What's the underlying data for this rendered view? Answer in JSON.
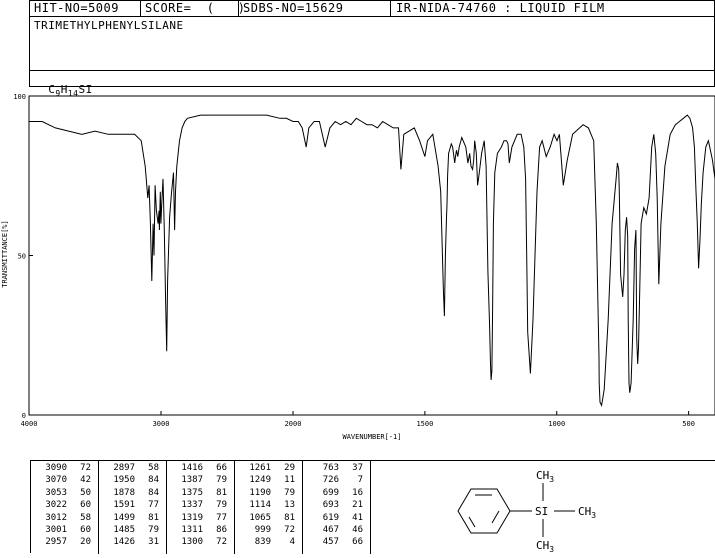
{
  "header": {
    "hit_no": "HIT-NO=5009",
    "score": "SCORE=  (   )",
    "sdbs_no": "SDBS-NO=15629",
    "ir_info": "IR-NIDA-74760 : LIQUID FILM",
    "compound_name": "TRIMETHYLPHENYLSILANE",
    "formula_prefix": "C",
    "formula_c_sub": "9",
    "formula_h": "H",
    "formula_h_sub": "14",
    "formula_suffix": "SI"
  },
  "structure": {
    "si_label": "SI",
    "ch3_top": "CH",
    "ch3_right": "CH",
    "ch3_bottom": "CH",
    "ch3_sub": "3"
  },
  "chart_data": {
    "type": "line",
    "title": "",
    "xlabel": "WAVENUMBER[-1]",
    "ylabel": "TRANSMITTANCE[%]",
    "xlim": [
      4000,
      400
    ],
    "ylim": [
      0,
      100
    ],
    "x_ticks": [
      "4000",
      "3000",
      "2000",
      "1500",
      "1000",
      "500"
    ],
    "x_tick_values": [
      4000,
      3000,
      2000,
      1500,
      1000,
      500
    ],
    "y_ticks": [
      "0",
      "50",
      "100"
    ],
    "y_tick_values": [
      0,
      50,
      100
    ],
    "x": [
      4000,
      3900,
      3800,
      3700,
      3600,
      3500,
      3400,
      3300,
      3200,
      3150,
      3120,
      3100,
      3090,
      3080,
      3070,
      3060,
      3053,
      3045,
      3035,
      3022,
      3015,
      3012,
      3005,
      3001,
      2995,
      2985,
      2975,
      2965,
      2957,
      2950,
      2935,
      2920,
      2905,
      2897,
      2890,
      2880,
      2860,
      2840,
      2820,
      2800,
      2700,
      2600,
      2500,
      2400,
      2300,
      2200,
      2100,
      2050,
      2000,
      1980,
      1965,
      1950,
      1940,
      1920,
      1900,
      1878,
      1860,
      1840,
      1820,
      1800,
      1780,
      1760,
      1740,
      1720,
      1700,
      1680,
      1660,
      1640,
      1620,
      1600,
      1591,
      1580,
      1560,
      1540,
      1520,
      1500,
      1490,
      1470,
      1450,
      1440,
      1435,
      1430,
      1426,
      1422,
      1418,
      1416,
      1414,
      1410,
      1400,
      1395,
      1390,
      1387,
      1384,
      1380,
      1375,
      1370,
      1360,
      1345,
      1337,
      1330,
      1325,
      1319,
      1315,
      1311,
      1305,
      1300,
      1295,
      1285,
      1275,
      1268,
      1261,
      1255,
      1251,
      1249,
      1246,
      1243,
      1240,
      1235,
      1225,
      1210,
      1200,
      1190,
      1185,
      1180,
      1170,
      1150,
      1135,
      1125,
      1118,
      1114,
      1110,
      1100,
      1090,
      1075,
      1065,
      1055,
      1040,
      1025,
      1010,
      999,
      990,
      975,
      960,
      940,
      900,
      880,
      860,
      850,
      845,
      840,
      839,
      836,
      830,
      820,
      805,
      790,
      775,
      770,
      765,
      763,
      758,
      750,
      745,
      740,
      735,
      731,
      729,
      726,
      723,
      718,
      710,
      705,
      700,
      699,
      697,
      693,
      690,
      685,
      680,
      670,
      660,
      650,
      640,
      632,
      625,
      619,
      613,
      605,
      590,
      570,
      550,
      535,
      520,
      505,
      495,
      485,
      478,
      472,
      467,
      462,
      457,
      452,
      445,
      435,
      425,
      410,
      400
    ],
    "y": [
      92,
      92,
      90,
      89,
      88,
      89,
      88,
      88,
      88,
      86,
      78,
      68,
      72,
      60,
      42,
      60,
      50,
      72,
      64,
      60,
      64,
      58,
      70,
      60,
      66,
      74,
      58,
      36,
      20,
      42,
      62,
      70,
      76,
      58,
      70,
      78,
      86,
      90,
      92,
      93,
      94,
      94,
      94,
      94,
      94,
      94,
      93,
      93,
      92,
      92,
      90,
      84,
      90,
      92,
      92,
      84,
      90,
      92,
      91,
      92,
      91,
      93,
      92,
      91,
      91,
      90,
      92,
      91,
      90,
      90,
      77,
      88,
      89,
      90,
      86,
      81,
      86,
      88,
      78,
      70,
      55,
      40,
      31,
      50,
      62,
      66,
      75,
      82,
      85,
      84,
      81,
      79,
      81,
      83,
      81,
      84,
      87,
      84,
      79,
      82,
      78,
      77,
      80,
      86,
      82,
      72,
      75,
      82,
      86,
      78,
      45,
      29,
      16,
      11,
      14,
      36,
      60,
      76,
      82,
      84,
      86,
      86,
      85,
      79,
      84,
      88,
      88,
      84,
      74,
      50,
      26,
      13,
      30,
      70,
      84,
      86,
      81,
      84,
      88,
      86,
      88,
      72,
      80,
      88,
      91,
      90,
      86,
      60,
      40,
      18,
      10,
      4,
      3,
      8,
      30,
      60,
      74,
      79,
      77,
      70,
      44,
      37,
      44,
      58,
      62,
      56,
      30,
      10,
      7,
      10,
      30,
      52,
      58,
      52,
      24,
      16,
      21,
      40,
      60,
      65,
      63,
      68,
      84,
      88,
      82,
      68,
      41,
      60,
      78,
      88,
      91,
      92,
      93,
      94,
      93,
      90,
      84,
      70,
      60,
      46,
      55,
      66,
      76,
      84,
      86,
      80,
      74,
      72
    ],
    "peaks": [
      [
        "3090",
        "72"
      ],
      [
        "3070",
        "42"
      ],
      [
        "3053",
        "50"
      ],
      [
        "3022",
        "60"
      ],
      [
        "3012",
        "58"
      ],
      [
        "3001",
        "60"
      ],
      [
        "2957",
        "20"
      ],
      [
        "2897",
        "58"
      ],
      [
        "1950",
        "84"
      ],
      [
        "1878",
        "84"
      ],
      [
        "1591",
        "77"
      ],
      [
        "1499",
        "81"
      ],
      [
        "1485",
        "79"
      ],
      [
        "1426",
        "31"
      ],
      [
        "1416",
        "66"
      ],
      [
        "1387",
        "79"
      ],
      [
        "1375",
        "81"
      ],
      [
        "1337",
        "79"
      ],
      [
        "1319",
        "77"
      ],
      [
        "1311",
        "86"
      ],
      [
        "1300",
        "72"
      ],
      [
        "1261",
        "29"
      ],
      [
        "1249",
        "11"
      ],
      [
        "1190",
        "79"
      ],
      [
        "1114",
        "13"
      ],
      [
        "1065",
        "81"
      ],
      [
        "999",
        "72"
      ],
      [
        "839",
        "4"
      ],
      [
        "763",
        "37"
      ],
      [
        "726",
        "7"
      ],
      [
        "699",
        "16"
      ],
      [
        "693",
        "21"
      ],
      [
        "619",
        "41"
      ],
      [
        "467",
        "46"
      ],
      [
        "457",
        "66"
      ]
    ]
  }
}
